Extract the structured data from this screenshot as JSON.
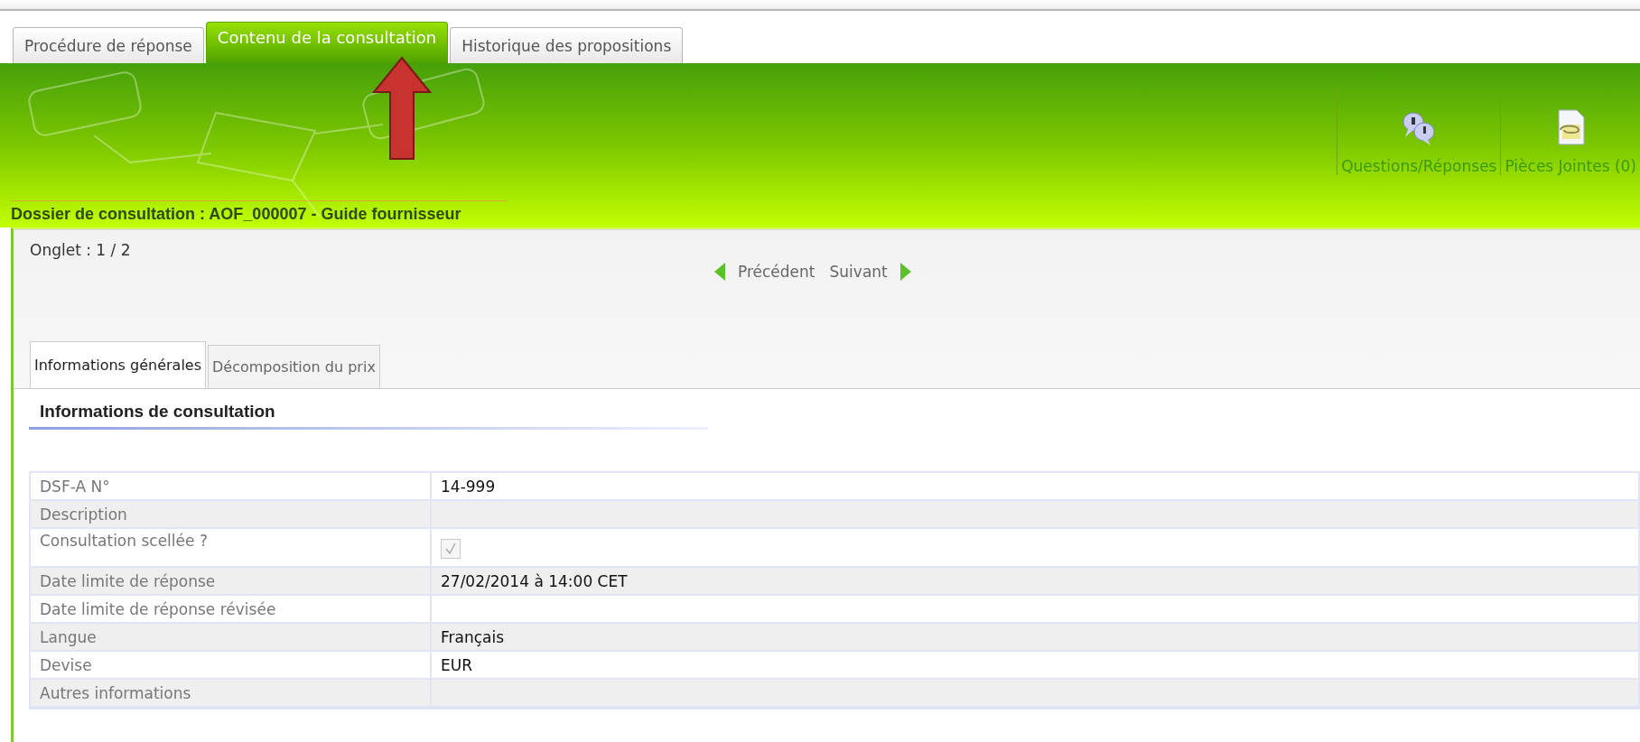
{
  "tabs": [
    {
      "label": "Procédure de réponse",
      "selected": false
    },
    {
      "label": "Contenu de la consultation",
      "selected": true
    },
    {
      "label": "Historique des propositions",
      "selected": false
    }
  ],
  "banner": {
    "actions": [
      {
        "label": "Questions/Réponses",
        "kind": "questions"
      },
      {
        "label": "Pièces Jointes (0)",
        "kind": "attachments"
      }
    ],
    "title": "Dossier de consultation : AOF_000007 - Guide fournisseur"
  },
  "pager": {
    "label": "Onglet : 1 / 2",
    "previous": "Précédent",
    "next": "Suivant"
  },
  "subtabs": [
    {
      "label": "Informations générales",
      "selected": true
    },
    {
      "label": "Décomposition du prix",
      "selected": false
    }
  ],
  "section": {
    "title": "Informations de consultation"
  },
  "table": {
    "rows": [
      {
        "label": "DSF-A N°",
        "kind": "text",
        "value": "14-999"
      },
      {
        "label": "Description",
        "kind": "text"
      },
      {
        "label": "Consultation scellée ?",
        "kind": "checkbox",
        "checked": true,
        "disabled": true
      },
      {
        "label": "Date limite de réponse",
        "kind": "text",
        "value": "27/02/2014 à 14:00 CET"
      },
      {
        "label": "Date limite de réponse révisée",
        "kind": "text"
      },
      {
        "label": "Langue",
        "kind": "text",
        "value": "Français"
      },
      {
        "label": "Devise",
        "kind": "text",
        "value": "EUR"
      },
      {
        "label": "Autres informations",
        "kind": "text"
      }
    ]
  }
}
